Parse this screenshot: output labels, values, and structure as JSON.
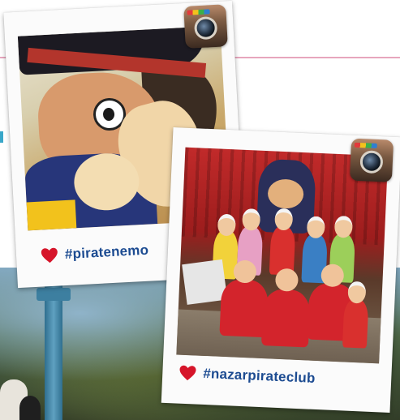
{
  "polaroids": [
    {
      "hashtag": "#piratenemo",
      "icon": "instagram-icon",
      "photo": "pirate-mascot-photo"
    },
    {
      "hashtag": "#nazarpirateclub",
      "icon": "instagram-icon",
      "photo": "group-photo"
    }
  ],
  "colors": {
    "accent_line": "#e7a6bd",
    "heart": "#d6152a",
    "hashtag": "#1c4b91"
  }
}
